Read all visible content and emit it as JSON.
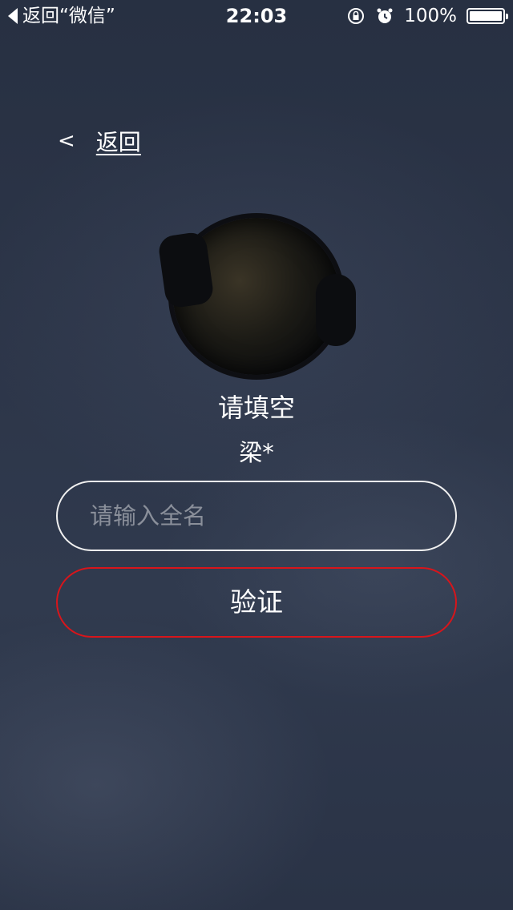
{
  "status_bar": {
    "back_label": "返回“微信”",
    "time": "22:03",
    "battery": "100%",
    "battery_level": 1.0
  },
  "nav": {
    "back_chevron": "<",
    "back_label": "返回"
  },
  "profile": {
    "title": "请填空",
    "hint": "梁*"
  },
  "form": {
    "name_placeholder": "请输入全名",
    "name_value": "",
    "verify_label": "验证"
  },
  "colors": {
    "verify_border": "#d8151b",
    "input_border": "#f0f0f0",
    "placeholder": "#8a8f9a"
  }
}
